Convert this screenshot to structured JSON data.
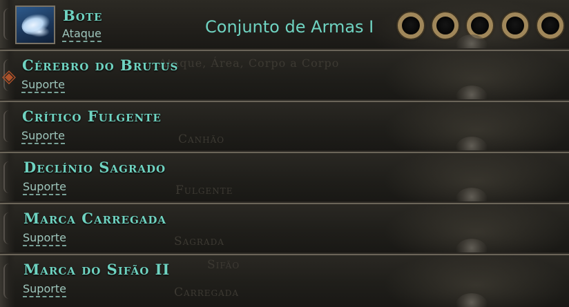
{
  "skill": {
    "name": "Bote",
    "type": "Ataque",
    "weapon_set": "Conjunto de Armas I",
    "icon": "beast-strike-icon",
    "sockets": 5
  },
  "supports": [
    {
      "name": "Cérebro do Brutus",
      "type": "Suporte"
    },
    {
      "name": "Crítico Fulgente",
      "type": "Suporte"
    },
    {
      "name": "Declínio Sagrado",
      "type": "Suporte"
    },
    {
      "name": "Marca Carregada",
      "type": "Suporte"
    },
    {
      "name": "Marca do Sifão II",
      "type": "Suporte"
    }
  ],
  "ghost_text": [
    "Ataque, Área, Corpo a Corpo",
    "Canhão",
    "Fulgente",
    "Sagrada",
    "Carregada",
    "Sifão"
  ],
  "colors": {
    "accent_text": "#6fd3c1",
    "socket_ring": "#a0875a",
    "link_highlight": "#b0522a"
  }
}
